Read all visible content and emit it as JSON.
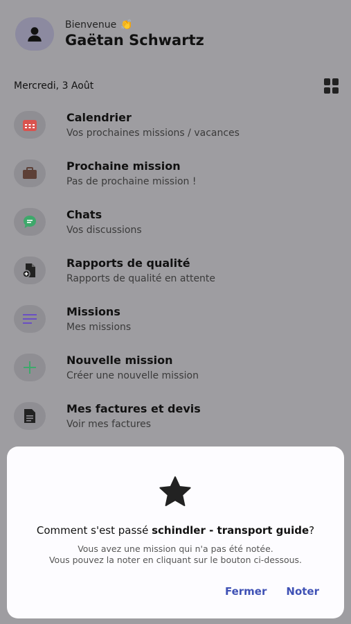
{
  "header": {
    "welcome": "Bienvenue",
    "wave_emoji": "👏",
    "user_name": "Gaëtan Schwartz"
  },
  "date": "Mercredi, 3 Août",
  "menu": [
    {
      "title": "Calendrier",
      "subtitle": "Vos prochaines missions / vacances",
      "icon": "calendar-icon",
      "color": "#d9534f"
    },
    {
      "title": "Prochaine mission",
      "subtitle": "Pas de prochaine mission !",
      "icon": "briefcase-icon",
      "color": "#5d4037"
    },
    {
      "title": "Chats",
      "subtitle": "Vos discussions",
      "icon": "chat-icon",
      "color": "#3ea86b"
    },
    {
      "title": "Rapports de qualité",
      "subtitle": "Rapports de qualité en attente",
      "icon": "report-icon",
      "color": "#222222"
    },
    {
      "title": "Missions",
      "subtitle": "Mes missions",
      "icon": "list-icon",
      "color": "#6a4fc4"
    },
    {
      "title": "Nouvelle mission",
      "subtitle": "Créer une nouvelle mission",
      "icon": "plus-icon",
      "color": "#3ea86b"
    },
    {
      "title": "Mes factures et devis",
      "subtitle": "Voir mes factures",
      "icon": "invoice-icon",
      "color": "#222222"
    }
  ],
  "dialog": {
    "question_prefix": "Comment s'est passé ",
    "mission_name": "schindler - transport guide",
    "question_suffix": "?",
    "line1": "Vous avez une mission qui n'a pas été notée.",
    "line2": "Vous pouvez la noter en cliquant sur le bouton ci-dessous.",
    "close_label": "Fermer",
    "rate_label": "Noter"
  }
}
